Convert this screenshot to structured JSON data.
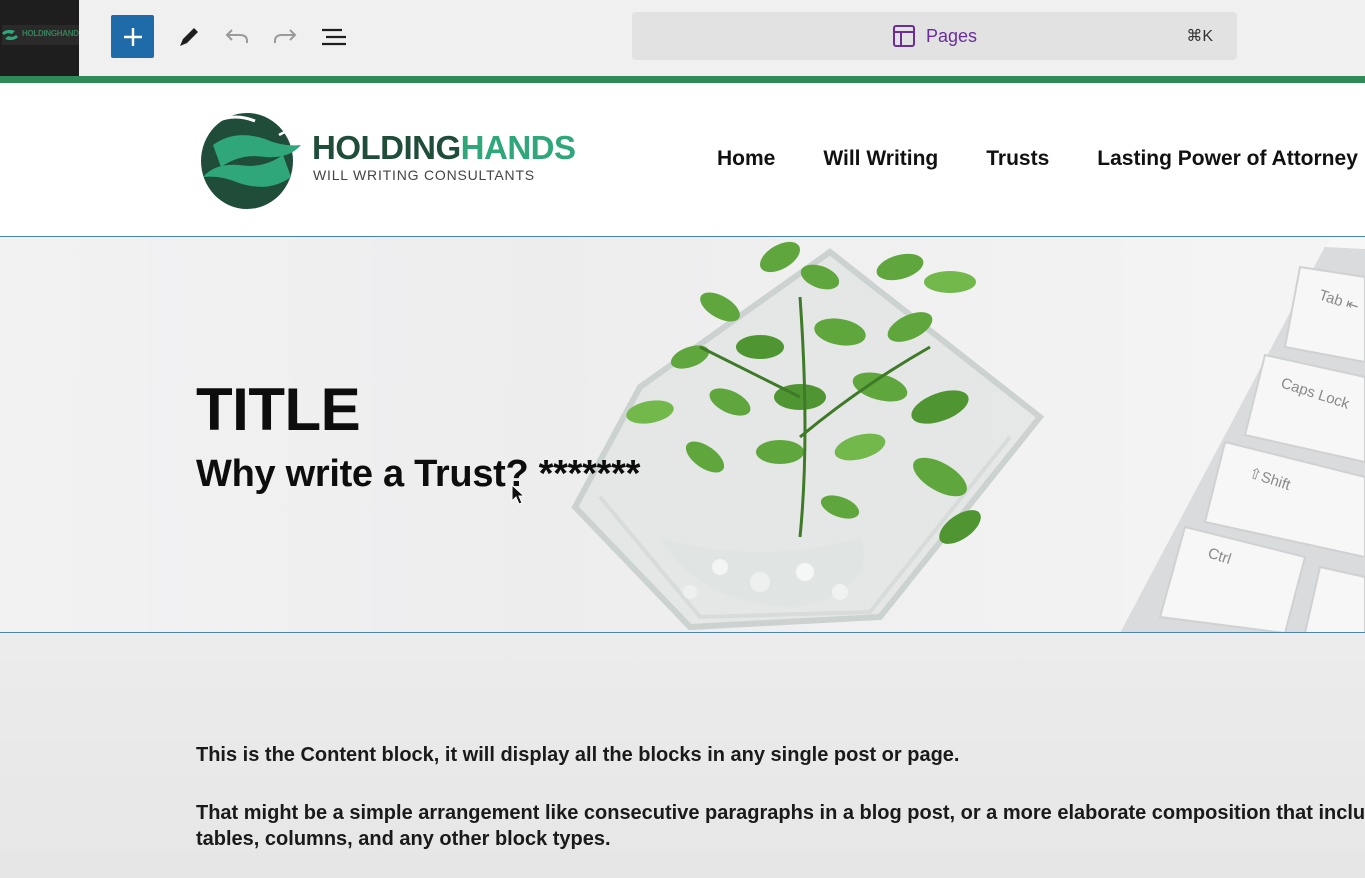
{
  "toolbar": {
    "site_icon_text": "HOLDINGHANDS",
    "command_bar_label": "Pages",
    "command_bar_shortcut": "⌘K",
    "add_icon": "plus-icon",
    "tool_icons": [
      "pencil-icon",
      "undo-icon",
      "redo-icon",
      "list-view-icon"
    ],
    "accent_color": "#2e8b57",
    "add_color": "#1f6aa8"
  },
  "header": {
    "brand_part1": "HOLDING",
    "brand_part2": "HANDS",
    "tagline": "WILL WRITING CONSULTANTS",
    "nav": [
      "Home",
      "Will Writing",
      "Trusts",
      "Lasting Power of Attorney"
    ]
  },
  "hero": {
    "title": "TITLE",
    "subtitle": "Why write a Trust? *******"
  },
  "content": {
    "paragraph1": "This is the Content block, it will display all the blocks in any single post or page.",
    "paragraph2_line1": "That might be a simple arrangement like consecutive paragraphs in a blog post, or a more elaborate composition that inclu",
    "paragraph2_line2": "tables, columns, and any other block types."
  }
}
